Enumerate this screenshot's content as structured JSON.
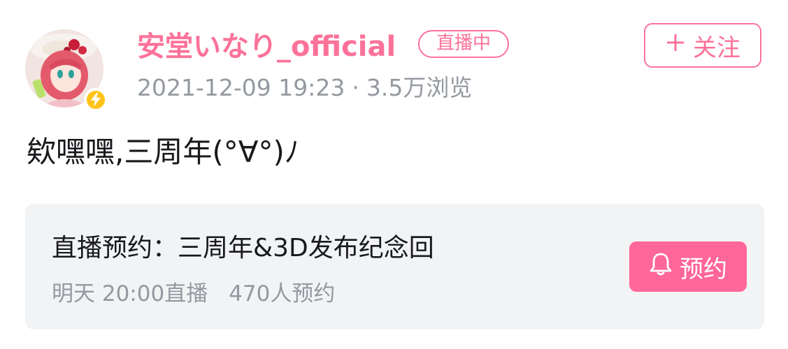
{
  "post": {
    "author": {
      "name": "安堂いなり_official",
      "live_badge": "直播中",
      "verified_icon": "lightning-icon"
    },
    "follow_button": {
      "label": "关注",
      "icon": "plus-icon"
    },
    "meta": {
      "datetime": "2021-12-09 19:23",
      "separator": "·",
      "views": "3.5万浏览"
    },
    "text": "欸嘿嘿,三周年(°∀°)ﾉ",
    "reservation": {
      "title": "直播预约：三周年&3D发布纪念回",
      "time": "明天 20:00直播",
      "count": "470人预约",
      "button_label": "预约",
      "button_icon": "bell-icon"
    }
  },
  "colors": {
    "brand_pink": "#fb7299",
    "button_pink": "#ff6699",
    "muted_text": "#9499a0",
    "primary_text": "#18191c",
    "card_bg": "#f2f3f5",
    "badge_yellow": "#ffc31a"
  }
}
